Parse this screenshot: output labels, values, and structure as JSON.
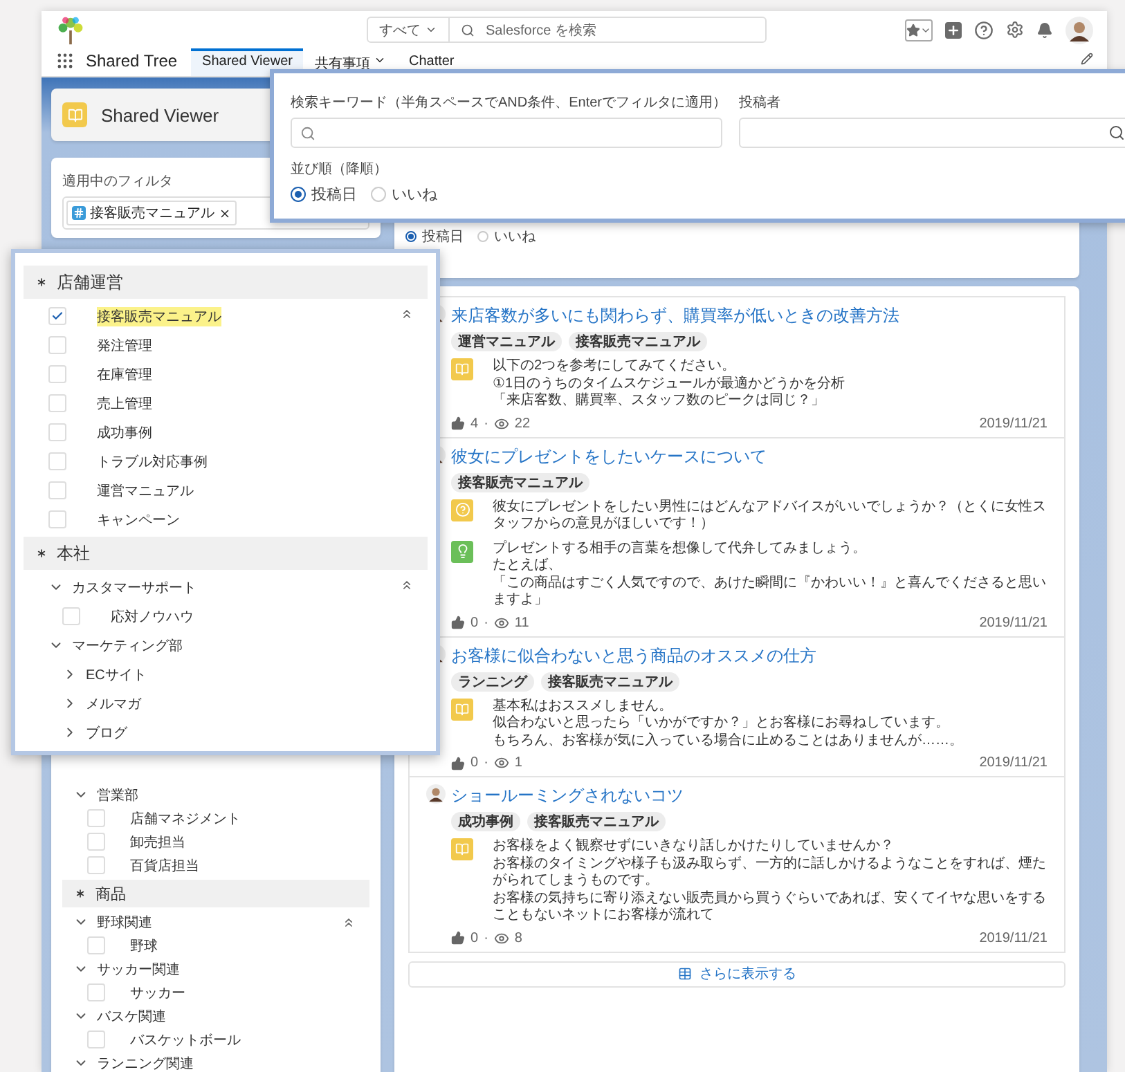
{
  "header": {
    "search_scope": "すべて",
    "search_placeholder": "Salesforce を検索"
  },
  "nav": {
    "app_name": "Shared Tree",
    "tabs": [
      {
        "label": "Shared Viewer",
        "selected": true,
        "has_menu": false
      },
      {
        "label": "共有事項",
        "selected": false,
        "has_menu": true
      },
      {
        "label": "Chatter",
        "selected": false,
        "has_menu": false
      }
    ]
  },
  "sidebar": {
    "title": "Shared Viewer",
    "active_filter_label": "適用中のフィルタ",
    "active_filters": [
      "接客販売マニュアル"
    ],
    "sections": [
      {
        "items": [
          {
            "label": "営業部",
            "kind": "folder",
            "expanded": true,
            "children": [
              {
                "label": "店舗マネジメント",
                "kind": "checkbox",
                "checked": false
              },
              {
                "label": "卸売担当",
                "kind": "checkbox",
                "checked": false
              },
              {
                "label": "百貨店担当",
                "kind": "checkbox",
                "checked": false
              }
            ]
          }
        ]
      },
      {
        "title": "商品",
        "items": [
          {
            "label": "野球関連",
            "kind": "folder",
            "expanded": true,
            "children": [
              {
                "label": "野球",
                "kind": "checkbox",
                "checked": false
              }
            ]
          },
          {
            "label": "サッカー関連",
            "kind": "folder",
            "expanded": true,
            "children": [
              {
                "label": "サッカー",
                "kind": "checkbox",
                "checked": false
              }
            ]
          },
          {
            "label": "バスケ関連",
            "kind": "folder",
            "expanded": true,
            "children": [
              {
                "label": "バスケットボール",
                "kind": "checkbox",
                "checked": false
              }
            ]
          },
          {
            "label": "ランニング関連",
            "kind": "folder",
            "expanded": true
          }
        ]
      }
    ]
  },
  "search_panel": {
    "sort_options": [
      {
        "label": "投稿日",
        "selected": true
      },
      {
        "label": "いいね",
        "selected": false
      }
    ]
  },
  "filter_popover": {
    "keyword_label": "検索キーワード（半角スペースでAND条件、Enterでフィルタに適用）",
    "poster_label": "投稿者",
    "sort_label": "並び順（降順）",
    "sort_options": [
      {
        "label": "投稿日",
        "selected": true
      },
      {
        "label": "いいね",
        "selected": false
      }
    ]
  },
  "category_popup": {
    "groups": [
      {
        "title": "店舗運営",
        "items": [
          {
            "label": "接客販売マニュアル",
            "kind": "checkbox",
            "checked": true
          },
          {
            "label": "発注管理",
            "kind": "checkbox",
            "checked": false
          },
          {
            "label": "在庫管理",
            "kind": "checkbox",
            "checked": false
          },
          {
            "label": "売上管理",
            "kind": "checkbox",
            "checked": false
          },
          {
            "label": "成功事例",
            "kind": "checkbox",
            "checked": false
          },
          {
            "label": "トラブル対応事例",
            "kind": "checkbox",
            "checked": false
          },
          {
            "label": "運営マニュアル",
            "kind": "checkbox",
            "checked": false
          },
          {
            "label": "キャンペーン",
            "kind": "checkbox",
            "checked": false
          }
        ]
      },
      {
        "title": "本社",
        "items": [
          {
            "label": "カスタマーサポート",
            "kind": "folder",
            "expanded": true,
            "children": [
              {
                "label": "応対ノウハウ",
                "kind": "checkbox",
                "checked": false
              }
            ]
          },
          {
            "label": "マーケティング部",
            "kind": "folder",
            "expanded": true,
            "children": [
              {
                "label": "ECサイト",
                "kind": "folder",
                "expanded": false
              },
              {
                "label": "メルマガ",
                "kind": "folder",
                "expanded": false
              },
              {
                "label": "ブログ",
                "kind": "folder",
                "expanded": false
              }
            ]
          }
        ]
      }
    ]
  },
  "posts": [
    {
      "title": "来店客数が多いにも関わらず、購買率が低いときの改善方法",
      "tags": [
        "運営マニュアル",
        "接客販売マニュアル"
      ],
      "entries": [
        {
          "kind": "article",
          "lines": [
            "以下の2つを参考にしてみてください。",
            "①1日のうちのタイムスケジュールが最適かどうかを分析",
            "「来店客数、購買率、スタッフ数のピークは同じ？」"
          ]
        }
      ],
      "likes": "4",
      "separator": "·",
      "views": "22",
      "date": "2019/11/21"
    },
    {
      "title": "彼女にプレゼントをしたいケースについて",
      "tags": [
        "接客販売マニュアル"
      ],
      "entries": [
        {
          "kind": "question",
          "lines": [
            "彼女にプレゼントをしたい男性にはどんなアドバイスがいいでしょうか？（とくに女性スタッフからの意見がほしいです！）"
          ]
        },
        {
          "kind": "answer",
          "lines": [
            "プレゼントする相手の言葉を想像して代弁してみましょう。",
            "たとえば、",
            "「この商品はすごく人気ですので、あけた瞬間に『かわいい！』と喜んでくださると思いますよ」"
          ]
        }
      ],
      "likes": "0",
      "separator": "·",
      "views": "11",
      "date": "2019/11/21"
    },
    {
      "title": "お客様に似合わないと思う商品のオススメの仕方",
      "tags": [
        "ランニング",
        "接客販売マニュアル"
      ],
      "entries": [
        {
          "kind": "article",
          "lines": [
            "基本私はおススメしません。",
            "似合わないと思ったら「いかがですか？」とお客様にお尋ねしています。",
            "もちろん、お客様が気に入っている場合に止めることはありませんが……。"
          ]
        }
      ],
      "likes": "0",
      "separator": "·",
      "views": "1",
      "date": "2019/11/21"
    },
    {
      "title": "ショールーミングされないコツ",
      "tags": [
        "成功事例",
        "接客販売マニュアル"
      ],
      "entries": [
        {
          "kind": "article",
          "lines": [
            "お客様をよく観察せずにいきなり話しかけたりしていませんか？",
            "お客様のタイミングや様子も汲み取らず、一方的に話しかけるようなことをすれば、煙たがられてしまうものです。",
            "お客様の気持ちに寄り添えない販売員から買うぐらいであれば、安くてイヤな思いをすることもないネットにお客様が流れて"
          ]
        }
      ],
      "likes": "0",
      "separator": "·",
      "views": "8",
      "date": "2019/11/21"
    }
  ],
  "show_more": "さらに表示する"
}
